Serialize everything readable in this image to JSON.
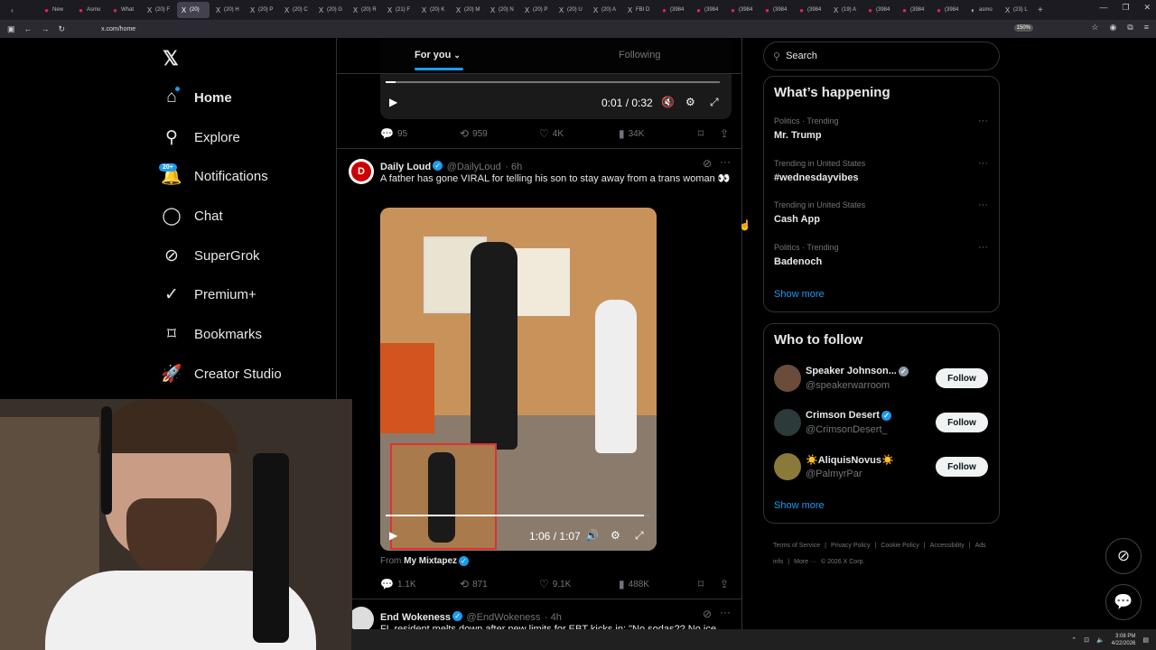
{
  "browser": {
    "tabs": [
      {
        "icon": "‹",
        "label": ""
      },
      {
        "icon": "●",
        "label": "New",
        "red": true
      },
      {
        "icon": "●",
        "label": "Asmo",
        "red": true
      },
      {
        "icon": "●",
        "label": "What",
        "red": true
      },
      {
        "icon": "X",
        "label": "(20) F"
      },
      {
        "icon": "X",
        "label": "(20)",
        "active": true
      },
      {
        "icon": "X",
        "label": "(20) H"
      },
      {
        "icon": "X",
        "label": "(20) P"
      },
      {
        "icon": "X",
        "label": "(20) C"
      },
      {
        "icon": "X",
        "label": "(20) G"
      },
      {
        "icon": "X",
        "label": "(20) R"
      },
      {
        "icon": "X",
        "label": "(21) F"
      },
      {
        "icon": "X",
        "label": "(20) K"
      },
      {
        "icon": "X",
        "label": "(20) M"
      },
      {
        "icon": "X",
        "label": "(20) N"
      },
      {
        "icon": "X",
        "label": "(20) P"
      },
      {
        "icon": "X",
        "label": "(20) U"
      },
      {
        "icon": "X",
        "label": "(20) A"
      },
      {
        "icon": "X",
        "label": "FBI D"
      },
      {
        "icon": "●",
        "label": "(3984",
        "red": true
      },
      {
        "icon": "●",
        "label": "(3984",
        "red": true
      },
      {
        "icon": "●",
        "label": "(3984",
        "red": true
      },
      {
        "icon": "●",
        "label": "(3984",
        "red": true
      },
      {
        "icon": "●",
        "label": "(3984",
        "red": true
      },
      {
        "icon": "X",
        "label": "(19) A"
      },
      {
        "icon": "●",
        "label": "(3984",
        "red": true
      },
      {
        "icon": "●",
        "label": "(3984",
        "red": true
      },
      {
        "icon": "●",
        "label": "(3984",
        "red": true
      },
      {
        "icon": "◐",
        "label": "asmo"
      },
      {
        "icon": "X",
        "label": "(23) L"
      }
    ],
    "url": "x.com/home",
    "zoom": "150%"
  },
  "sidebar": {
    "logo": "𝕏",
    "items": [
      {
        "icon": "⌂",
        "label": "Home"
      },
      {
        "icon": "⚲",
        "label": "Explore"
      },
      {
        "icon": "🔔",
        "label": "Notifications"
      },
      {
        "icon": "◯",
        "label": "Chat"
      },
      {
        "icon": "⊘",
        "label": "SuperGrok"
      },
      {
        "icon": "✓",
        "label": "Premium+"
      },
      {
        "icon": "⌑",
        "label": "Bookmarks"
      },
      {
        "icon": "🚀",
        "label": "Creator Studio"
      }
    ],
    "notif_badge": "20+"
  },
  "feed": {
    "tab_for_you": "For you",
    "tab_following": "Following",
    "post1": {
      "time": "0:01 / 0:32",
      "progress": 0.03,
      "replies": "95",
      "reposts": "959",
      "likes": "4K",
      "views": "34K"
    },
    "post2": {
      "name": "Daily Loud",
      "handle": "@DailyLoud",
      "age": "· 6h",
      "text": "A father has gone VIRAL for telling his son to stay away from a trans woman 👀",
      "time": "1:06 / 1:07",
      "progress": 0.98,
      "from_label": "From",
      "from_name": "My Mixtapez",
      "replies": "1.1K",
      "reposts": "871",
      "likes": "9.1K",
      "views": "488K"
    },
    "post3": {
      "name": "End Wokeness",
      "handle": "@EndWokeness",
      "age": "· 4h",
      "text": "FL resident melts down after new limits for EBT kicks in: \"No sodas?? No ice"
    }
  },
  "right": {
    "search_placeholder": "Search",
    "happening_title": "What’s happening",
    "trends": [
      {
        "cat": "Politics · Trending",
        "name": "Mr. Trump"
      },
      {
        "cat": "Trending in United States",
        "name": "#wednesdayvibes"
      },
      {
        "cat": "Trending in United States",
        "name": "Cash App"
      },
      {
        "cat": "Politics · Trending",
        "name": "Badenoch"
      }
    ],
    "show_more": "Show more",
    "wtf_title": "Who to follow",
    "wtf": [
      {
        "name": "Speaker Johnson...",
        "handle": "@speakerwarroom"
      },
      {
        "name": "Crimson Desert",
        "handle": "@CrimsonDesert_"
      },
      {
        "name": "☀️AliquisNovus☀️",
        "handle": "@PalmyrPar"
      }
    ],
    "follow_label": "Follow",
    "footer": [
      "Terms of Service",
      "|",
      "Privacy Policy",
      "|",
      "Cookie Policy",
      "|",
      "Accessibility",
      "|",
      "Ads info",
      "|",
      "More ···",
      "© 2026 X Corp."
    ]
  },
  "taskbar": {
    "time": "3:08 PM",
    "date": "4/22/2026"
  },
  "colors": {
    "accent": "#1d9bf0",
    "bg": "#000000",
    "border": "#2f3336",
    "muted": "#71767b"
  }
}
